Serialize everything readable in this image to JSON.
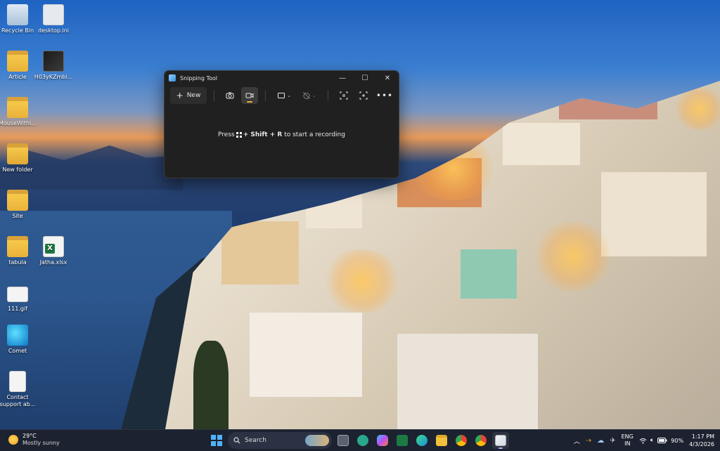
{
  "desktop_icons": [
    {
      "label": "Recycle Bin",
      "icon": "recycle-bin-icon"
    },
    {
      "label": "desktop.ini",
      "icon": "settings-file-icon"
    },
    {
      "label": "Article",
      "icon": "folder-icon"
    },
    {
      "label": "H03yKZmbi...",
      "icon": "image-file-icon"
    },
    {
      "label": "MouseWithi...",
      "icon": "folder-icon"
    },
    {
      "label": "New folder",
      "icon": "folder-icon"
    },
    {
      "label": "Site",
      "icon": "folder-icon"
    },
    {
      "label": "tabula",
      "icon": "folder-icon"
    },
    {
      "label": "Jatha.xlsx",
      "icon": "excel-file-icon"
    },
    {
      "label": "111.gif",
      "icon": "gif-file-icon"
    },
    {
      "label": "Comet",
      "icon": "comet-app-icon"
    },
    {
      "label": "Contact support ab...",
      "icon": "document-file-icon"
    }
  ],
  "snipping_tool": {
    "title": "Snipping Tool",
    "new_label": "New",
    "instruction_pre": "Press ",
    "instruction_keys": "+ Shift + R",
    "instruction_post": " to start a recording",
    "mode": "video"
  },
  "taskbar": {
    "weather_temp": "29°C",
    "weather_desc": "Mostly sunny",
    "search_placeholder": "Search",
    "lang_top": "ENG",
    "lang_bottom": "IN",
    "battery": "90%",
    "time": "1:17 PM",
    "date": "4/3/2026",
    "apps": [
      "file-explorer",
      "chatgpt",
      "copilot",
      "excel",
      "edge",
      "folder",
      "chrome",
      "chrome-profile",
      "snipping-tool"
    ]
  }
}
